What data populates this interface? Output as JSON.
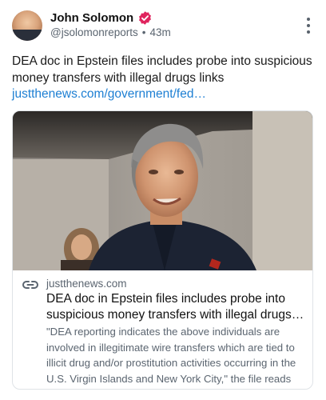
{
  "author": {
    "name": "John Solomon",
    "handle": "@jsolomonreports",
    "separator": "•",
    "time": "43m",
    "verified_color": "#e0245e"
  },
  "post": {
    "text": "DEA doc in Epstein files includes probe into suspicious money transfers with illegal drugs links",
    "link_text": "justthenews.com/government/fed…",
    "link_color": "#1d7fd3"
  },
  "card": {
    "domain": "justthenews.com",
    "title": "DEA doc in Epstein files includes probe into suspicious money transfers with illegal drugs li…",
    "description": "\"DEA reporting indicates the above individuals are involved in illegitimate wire transfers which are tied to illicit drug and/or prostitution activities occurring in the U.S. Virgin Islands and New York City,\" the file reads",
    "icon": "link-icon"
  },
  "icons": {
    "more": "more-vertical-icon",
    "verified": "verified-badge-icon"
  }
}
